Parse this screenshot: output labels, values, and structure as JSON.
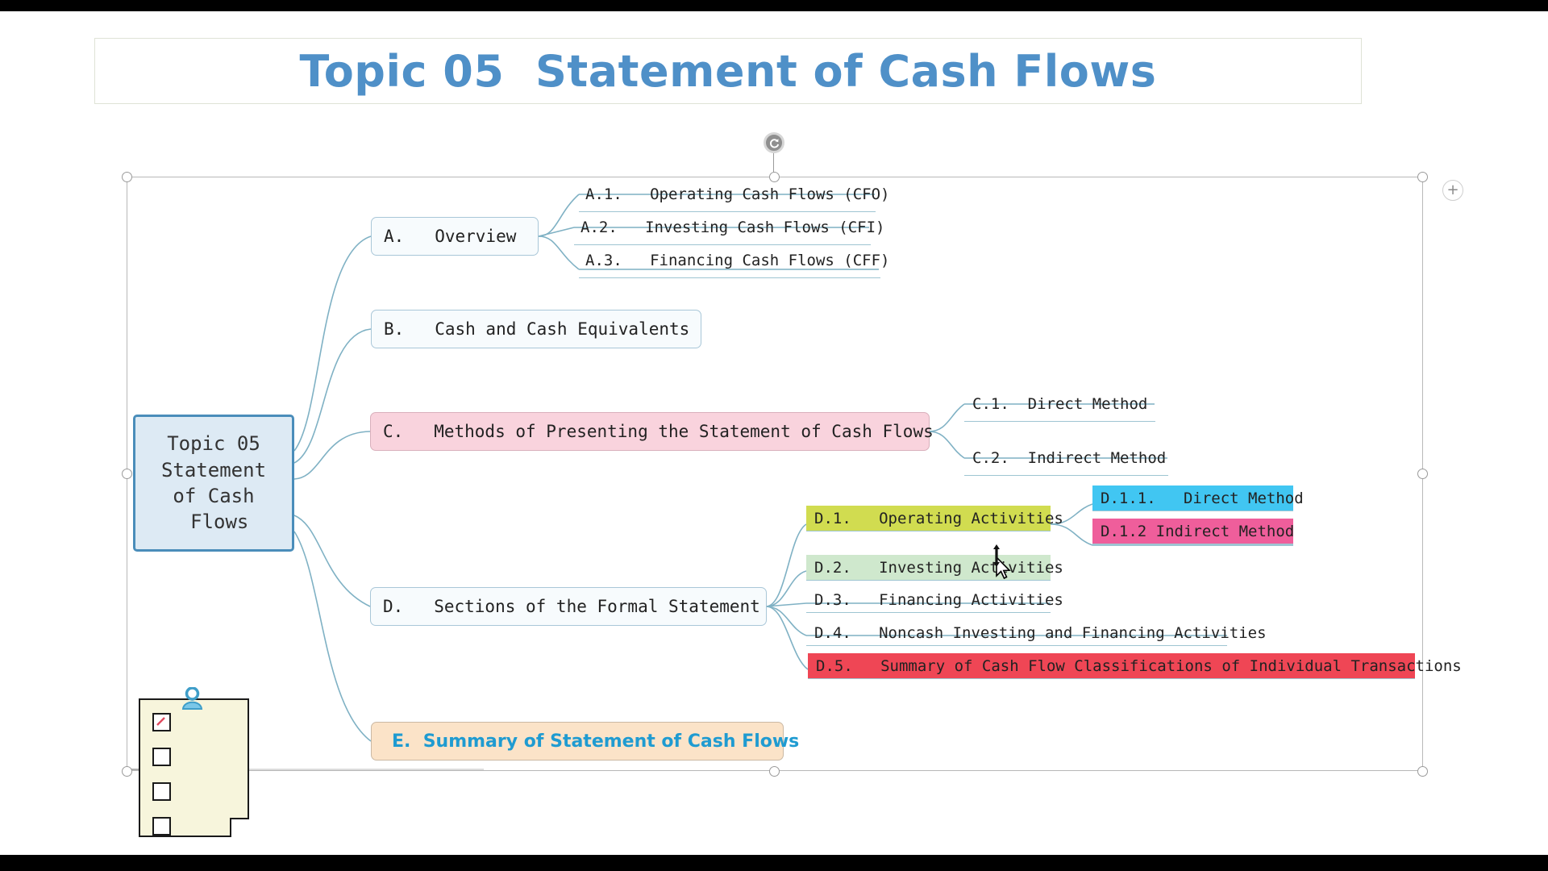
{
  "slide": {
    "title": "Topic 05  Statement of Cash Flows",
    "title_color": "#4f90c8"
  },
  "canvas_controls": {
    "rotate_handle": "rotate-handle",
    "add_button": "+",
    "selection_handles": 8
  },
  "mindmap": {
    "central": {
      "lines": [
        "Topic 05",
        "Statement",
        "of Cash",
        " Flows"
      ],
      "fill": "#ddeaf4",
      "border": "#4a8dba"
    },
    "branches": [
      {
        "id": "A",
        "label": "A.   Overview",
        "style": "box",
        "children": [
          {
            "id": "A.1",
            "label": "A.1.   Operating Cash Flows (CFO)",
            "style": "underline"
          },
          {
            "id": "A.2",
            "label": "A.2.   Investing Cash Flows (CFI)",
            "style": "underline"
          },
          {
            "id": "A.3",
            "label": "A.3.   Financing Cash Flows (CFF)",
            "style": "underline"
          }
        ]
      },
      {
        "id": "B",
        "label": "B.   Cash and Cash Equivalents",
        "style": "box",
        "children": []
      },
      {
        "id": "C",
        "label": "C.   Methods of Presenting the Statement of Cash Flows",
        "style": "box",
        "fill": "#f9d3dd",
        "children": [
          {
            "id": "C.1",
            "label": "C.1.  Direct Method",
            "style": "underline"
          },
          {
            "id": "C.2",
            "label": "C.2.  Indirect Method",
            "style": "underline"
          }
        ]
      },
      {
        "id": "D",
        "label": "D.   Sections of the Formal Statement",
        "style": "box",
        "children": [
          {
            "id": "D.1",
            "label": "D.1.   Operating Activities",
            "style": "filled",
            "fill": "#d1dc50",
            "children": [
              {
                "id": "D.1.1",
                "label": "D.1.1.   Direct Method",
                "style": "filled",
                "fill": "#41c6f2"
              },
              {
                "id": "D.1.2",
                "label": "D.1.2 Indirect Method",
                "style": "filled",
                "fill": "#ef5e9b"
              }
            ]
          },
          {
            "id": "D.2",
            "label": "D.2.   Investing Activities",
            "style": "filled",
            "fill": "#cfe8cd"
          },
          {
            "id": "D.3",
            "label": "D.3.   Financing Activities",
            "style": "underline",
            "fill": "transparent"
          },
          {
            "id": "D.4",
            "label": "D.4.   Noncash Investing and Financing Activities",
            "style": "underline",
            "fill": "transparent"
          },
          {
            "id": "D.5",
            "label": "D.5.   Summary of Cash Flow Classifications of Individual Transactions",
            "style": "filled",
            "fill": "#ef4655"
          }
        ]
      },
      {
        "id": "E",
        "label": "E.  Summary of Statement of Cash Flows",
        "style": "box",
        "fill": "#fbe3c8",
        "text_color": "#1f9bd1",
        "children": []
      }
    ]
  },
  "sticky_note": {
    "name": "checklist-note",
    "paper_color": "#f7f5dc",
    "clip_color": "#7ac7e8",
    "checkbox_count": 4,
    "checked_index": 0
  }
}
